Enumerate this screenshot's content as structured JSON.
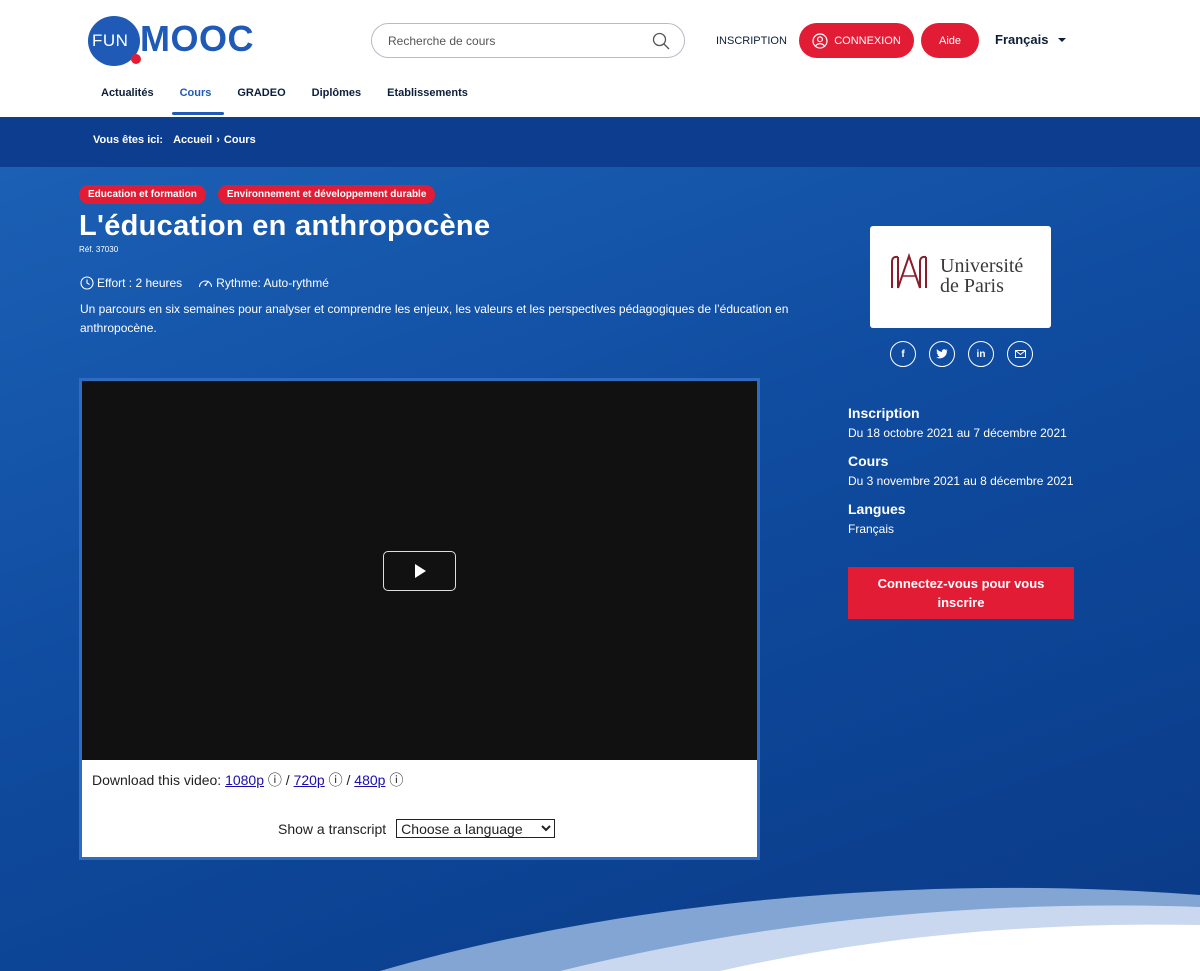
{
  "logo": {
    "fun": "FUN",
    "mooc": "MOOC"
  },
  "search": {
    "placeholder": "Recherche de cours"
  },
  "header": {
    "inscription": "INSCRIPTION",
    "connexion": "CONNEXION",
    "aide": "Aide",
    "language": "Français"
  },
  "nav": {
    "items": [
      {
        "label": "Actualités"
      },
      {
        "label": "Cours"
      },
      {
        "label": "GRADEO"
      },
      {
        "label": "Diplômes"
      },
      {
        "label": "Etablissements"
      }
    ],
    "active": "Cours"
  },
  "breadcrumb": {
    "label": "Vous êtes ici:",
    "home": "Accueil",
    "separator": "›",
    "current": "Cours"
  },
  "course": {
    "tags": [
      "Education et formation",
      "Environnement et développement durable"
    ],
    "title": "L'éducation en anthropocène",
    "ref": "Réf. 37030",
    "effort": "Effort : 2 heures",
    "rhythm": "Rythme: Auto-rythmé",
    "description": "Un parcours en six semaines pour analyser et comprendre les enjeux, les valeurs et les perspectives pédagogiques de l’éducation en anthropocène."
  },
  "video": {
    "download_label": "Download this video:",
    "q1080": "1080p",
    "q720": "720p",
    "q480": "480p",
    "info_glyph": "ⓘ",
    "slash": "/",
    "transcript_label": "Show a transcript",
    "language_select": "Choose a language"
  },
  "partner": {
    "line1": "Université",
    "line2": "de Paris"
  },
  "social": {
    "facebook": "f",
    "linkedin": "in"
  },
  "sidebar": {
    "inscription_title": "Inscription",
    "inscription_dates": "Du 18 octobre 2021 au 7 décembre 2021",
    "cours_title": "Cours",
    "cours_dates": "Du 3 novembre 2021 au 8 décembre 2021",
    "langues_title": "Langues",
    "langues_value": "Français",
    "cta": "Connectez-vous pour vous inscrire"
  },
  "colors": {
    "brand_blue": "#1e5ab6",
    "accent_red": "#e31c35",
    "band_blue": "#0c3d8f"
  }
}
